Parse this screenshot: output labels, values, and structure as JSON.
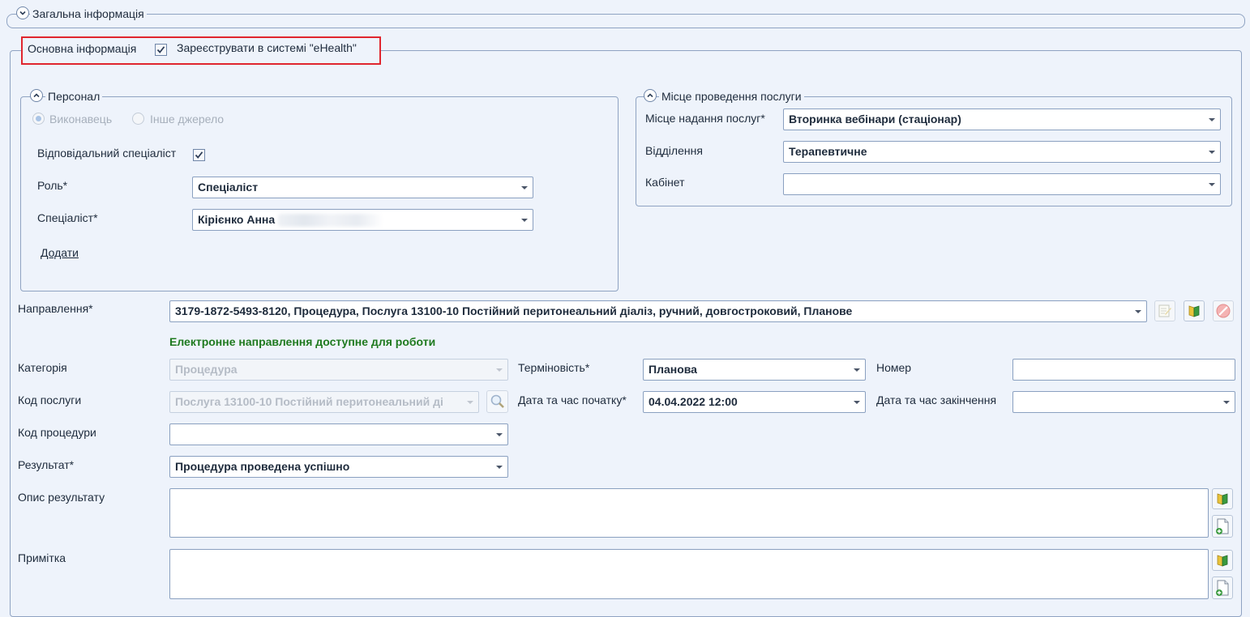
{
  "general_section": {
    "title": "Загальна інформація"
  },
  "tab_header": {
    "label": "Основна інформація",
    "ehealth_label": "Зареєструвати в системі \"eHealth\"",
    "ehealth_checked": true,
    "highlight_color": "#e0262f"
  },
  "personnel": {
    "title": "Персонал",
    "radio_executor": "Виконавець",
    "radio_other": "Інше джерело",
    "responsible_label": "Відповідальний спеціаліст",
    "role_label": "Роль*",
    "role_value": "Спеціаліст",
    "specialist_label": "Спеціаліст*",
    "specialist_value": "Кірієнко Анна",
    "add_link": "Додати"
  },
  "location": {
    "title": "Місце проведення послуги",
    "place_label": "Місце надання послуг*",
    "place_value": "Вторинка вебінари (стаціонар)",
    "department_label": "Відділення",
    "department_value": "Терапевтичне",
    "cabinet_label": "Кабінет",
    "cabinet_value": ""
  },
  "referral": {
    "label": "Направлення*",
    "value": "3179-1872-5493-8120, Процедура, Послуга 13100-10 Постійний перитонеальний діаліз, ручний, довгостроковий, Планове",
    "status": "Електронне направлення доступне для роботи",
    "status_color": "#1f7a1f"
  },
  "fields": {
    "category_label": "Категорія",
    "category_value": "Процедура",
    "urgency_label": "Терміновість*",
    "urgency_value": "Планова",
    "number_label": "Номер",
    "number_value": "",
    "service_code_label": "Код послуги",
    "service_code_value": "Послуга 13100-10 Постійний перитонеальний ді",
    "start_label": "Дата та час початку*",
    "start_value": "04.04.2022 12:00",
    "end_label": "Дата та час закінчення",
    "end_value": "",
    "procedure_code_label": "Код процедури",
    "procedure_code_value": "",
    "result_label": "Результат*",
    "result_value": "Процедура проведена успішно",
    "result_desc_label": "Опис результату",
    "note_label": "Примітка"
  },
  "icons": {
    "edit": "edit-note-icon",
    "book": "book-icon",
    "cancel": "cancel-icon",
    "search": "magnifier-icon",
    "add_doc": "add-document-icon"
  }
}
